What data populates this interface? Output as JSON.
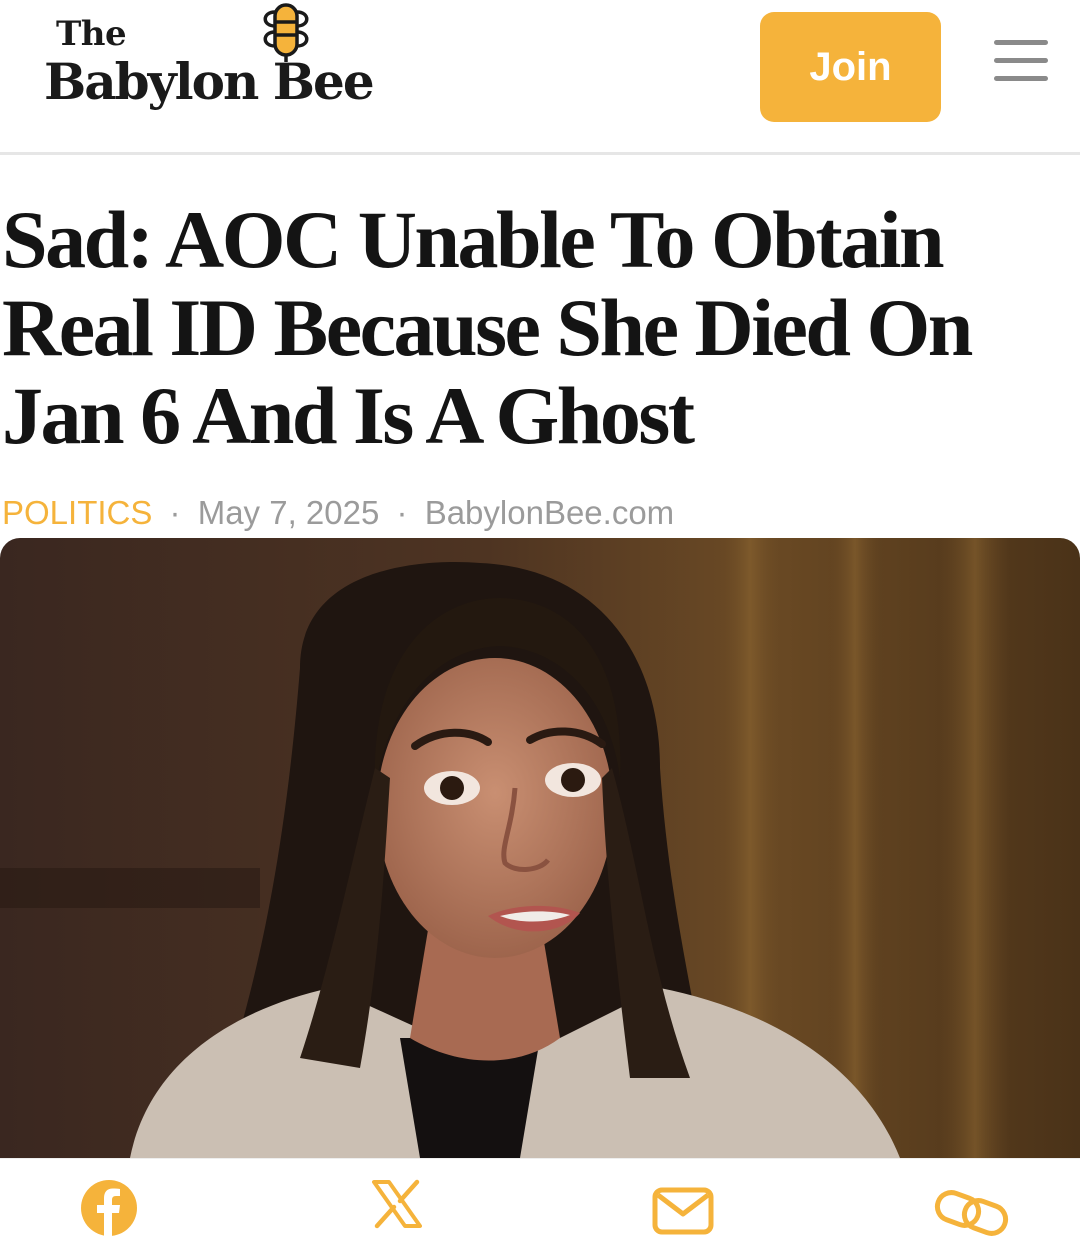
{
  "brand": {
    "logo_top": "The",
    "logo_bottom": "Babylon Bee",
    "accent_color": "#f5b33b"
  },
  "header": {
    "join_label": "Join",
    "menu_icon": "hamburger-menu-icon"
  },
  "article": {
    "headline": "Sad: AOC Unable To Obtain Real ID Because She Died On Jan 6 And Is A Ghost",
    "category": "POLITICS",
    "date": "May 7, 2025",
    "source": "BabylonBee.com",
    "separator": "·",
    "image": "photo of a woman with long dark hair in a light blazer speaking in an interview"
  },
  "share": {
    "buttons": [
      "facebook-icon",
      "x-icon",
      "email-icon",
      "link-icon"
    ]
  }
}
